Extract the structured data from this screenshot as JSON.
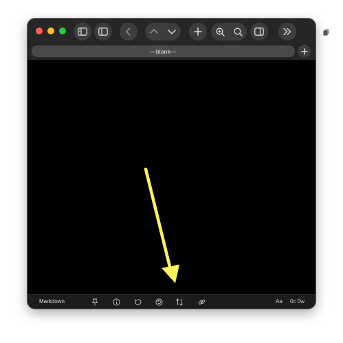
{
  "window": {
    "tab_title": "—blank—"
  },
  "toolbar": {
    "icons": [
      "sidebar-icon",
      "panel-icon",
      "chevron-left-icon",
      "chevron-up-icon",
      "chevron-down-icon",
      "plus-icon",
      "zoom-in-icon",
      "search-icon",
      "split-view-icon",
      "double-chevron-right-icon"
    ]
  },
  "statusbar": {
    "mode": "Markdown",
    "font_label": "Aa",
    "counts": "0c 0w",
    "icons": [
      "pin-icon",
      "info-icon",
      "undo-icon",
      "revert-icon",
      "sort-icon",
      "link-icon"
    ]
  },
  "annotation": {
    "color": "#fff45a"
  }
}
